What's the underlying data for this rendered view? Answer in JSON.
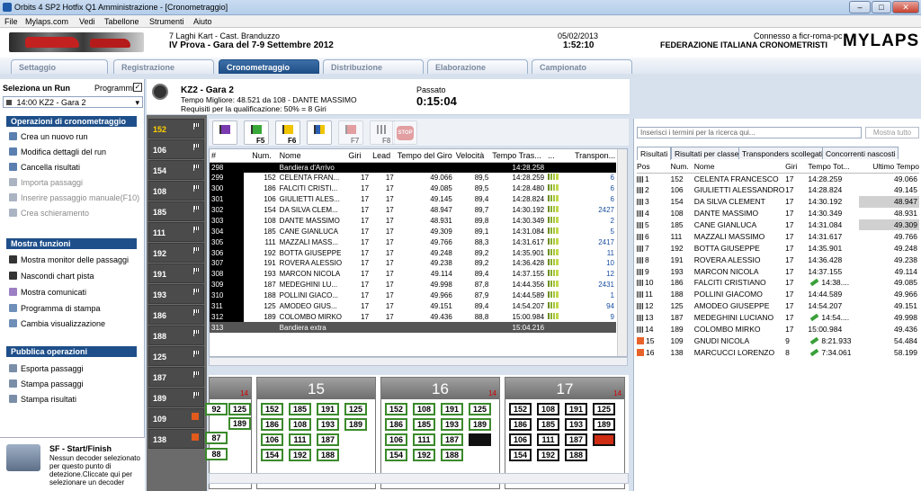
{
  "window": {
    "title": "Orbits 4 SP2 Hotfix Q1 Amministrazione - [Cronometraggio]",
    "buttons": [
      "–",
      "□",
      "✕"
    ]
  },
  "menu": [
    "File",
    "Mylaps.com",
    "Vedi",
    "Tabellone",
    "Strumenti",
    "Aiuto"
  ],
  "header": {
    "event_line1": "7 Laghi Kart - Cast. Branduzzo",
    "event_line2": "IV Prova - Gara del 7-9 Settembre 2012",
    "date": "05/02/2013",
    "time": "1:52:10",
    "connection": "Connesso a ficr-roma-pc",
    "federation": "FEDERAZIONE ITALIANA CRONOMETRISTI",
    "brand": "MYLAPS"
  },
  "tabs": [
    "Settaggio",
    "Registrazione",
    "Cronometraggio",
    "Distribuzione",
    "Elaborazione",
    "Campionato"
  ],
  "left": {
    "select_run_label": "Seleziona un Run",
    "programmi_label": "Programmi",
    "programmi_checked": "✓",
    "run_value": "14:00   KZ2 - Gara 2",
    "sec1_title": "Operazioni di cronometraggio",
    "sec1_items": [
      "Crea un nuovo run",
      "Modifica dettagli del run",
      "Cancella risultati",
      "Importa passaggi",
      "Inserire passaggio manuale(F10)",
      "Crea schieramento"
    ],
    "sec2_title": "Mostra funzioni",
    "sec2_items": [
      "Mostra monitor delle passaggi",
      "Nascondi chart pista",
      "Mostra comunicati",
      "Programma di stampa",
      "Cambia visualizzazione"
    ],
    "sec3_title": "Pubblica operazioni",
    "sec3_items": [
      "Esporta passaggi",
      "Stampa passaggi",
      "Stampa risultati"
    ],
    "sf_title": "SF - Start/Finish",
    "sf_text": "Nessun decoder selezionato per questo punto di detezione.Cliccate qui per selezionare un decoder"
  },
  "race": {
    "name": "KZ2 - Gara 2",
    "best": "Tempo Migliore: 48.521 da 108 - DANTE MASSIMO",
    "req": "Requisiti per la qualificazione: 50% = 8 Giri",
    "elapsed_label": "Passato",
    "elapsed": "0:15:04"
  },
  "numbers_col": [
    "152",
    "106",
    "154",
    "108",
    "185",
    "111",
    "192",
    "191",
    "193",
    "186",
    "188",
    "125",
    "187",
    "189",
    "109",
    "138"
  ],
  "flags": [
    "",
    "F5",
    "F6",
    "",
    "F7",
    "F8",
    "STOP"
  ],
  "grid": {
    "headers": [
      "#",
      "Num.",
      "Nome",
      "Giri",
      "Lead",
      "Tempo del Giro",
      "Velocità",
      "Tempo Tras...",
      "...",
      "Transpon..."
    ],
    "rows": [
      {
        "id": "298",
        "num": "",
        "name": "Bandiera d'Arrivo",
        "giri": "",
        "lead": "",
        "lap": "",
        "vel": "",
        "tt": "14:28.258",
        "tr": "",
        "type": "blk"
      },
      {
        "id": "299",
        "num": "152",
        "name": "CELENTA FRAN...",
        "giri": "17",
        "lead": "17",
        "lap": "49.066",
        "vel": "89,5",
        "tt": "14:28.259",
        "tr": "6"
      },
      {
        "id": "300",
        "num": "186",
        "name": "FALCITI CRISTI...",
        "giri": "17",
        "lead": "17",
        "lap": "49.085",
        "vel": "89,5",
        "tt": "14:28.480",
        "tr": "6"
      },
      {
        "id": "301",
        "num": "106",
        "name": "GIULIETTI ALES...",
        "giri": "17",
        "lead": "17",
        "lap": "49.145",
        "vel": "89,4",
        "tt": "14:28.824",
        "tr": "6"
      },
      {
        "id": "302",
        "num": "154",
        "name": "DA SILVA CLEM...",
        "giri": "17",
        "lead": "17",
        "lap": "48.947",
        "vel": "89,7",
        "tt": "14:30.192",
        "tr": "2427"
      },
      {
        "id": "303",
        "num": "108",
        "name": "DANTE MASSIMO",
        "giri": "17",
        "lead": "17",
        "lap": "48.931",
        "vel": "89,8",
        "tt": "14:30.349",
        "tr": "2"
      },
      {
        "id": "304",
        "num": "185",
        "name": "CANE GIANLUCA",
        "giri": "17",
        "lead": "17",
        "lap": "49.309",
        "vel": "89,1",
        "tt": "14:31.084",
        "tr": "5"
      },
      {
        "id": "305",
        "num": "111",
        "name": "MAZZALI MASS...",
        "giri": "17",
        "lead": "17",
        "lap": "49.766",
        "vel": "88,3",
        "tt": "14:31.617",
        "tr": "2417"
      },
      {
        "id": "306",
        "num": "192",
        "name": "BOTTA GIUSEPPE",
        "giri": "17",
        "lead": "17",
        "lap": "49.248",
        "vel": "89,2",
        "tt": "14:35.901",
        "tr": "11"
      },
      {
        "id": "307",
        "num": "191",
        "name": "ROVERA ALESSIO",
        "giri": "17",
        "lead": "17",
        "lap": "49.238",
        "vel": "89,2",
        "tt": "14:36.428",
        "tr": "10"
      },
      {
        "id": "308",
        "num": "193",
        "name": "MARCON NICOLA",
        "giri": "17",
        "lead": "17",
        "lap": "49.114",
        "vel": "89,4",
        "tt": "14:37.155",
        "tr": "12"
      },
      {
        "id": "309",
        "num": "187",
        "name": "MEDEGHINI LU...",
        "giri": "17",
        "lead": "17",
        "lap": "49.998",
        "vel": "87,8",
        "tt": "14:44.356",
        "tr": "2431"
      },
      {
        "id": "310",
        "num": "188",
        "name": "POLLINI GIACO...",
        "giri": "17",
        "lead": "17",
        "lap": "49.966",
        "vel": "87,9",
        "tt": "14:44.589",
        "tr": "1"
      },
      {
        "id": "311",
        "num": "125",
        "name": "AMODEO GIUS...",
        "giri": "17",
        "lead": "17",
        "lap": "49.151",
        "vel": "89,4",
        "tt": "14:54.207",
        "tr": "94"
      },
      {
        "id": "312",
        "num": "189",
        "name": "COLOMBO MIRKO",
        "giri": "17",
        "lead": "17",
        "lap": "49.436",
        "vel": "88,8",
        "tt": "15:00.984",
        "tr": "9"
      },
      {
        "id": "313",
        "num": "",
        "name": "Bandiera extra",
        "giri": "",
        "lead": "",
        "lap": "",
        "vel": "",
        "tt": "15:04.216",
        "tr": "",
        "type": "gray"
      }
    ]
  },
  "laps": [
    {
      "lap": "",
      "sub": "14",
      "cells": [
        "92",
        "125",
        "189",
        "",
        "",
        "",
        "87",
        "",
        "",
        "88",
        "",
        ""
      ]
    },
    {
      "lap": "15",
      "sub": "",
      "cells": [
        "152",
        "185",
        "191",
        "125",
        "186",
        "108",
        "193",
        "189",
        "106",
        "111",
        "187",
        "",
        "154",
        "192",
        "188",
        ""
      ]
    },
    {
      "lap": "16",
      "sub": "14",
      "cells": [
        "152",
        "108",
        "191",
        "125",
        "186",
        "185",
        "193",
        "189",
        "106",
        "111",
        "187",
        "",
        "154",
        "192",
        "188",
        ""
      ]
    },
    {
      "lap": "17",
      "sub": "14",
      "cells": [
        "152",
        "108",
        "191",
        "125",
        "186",
        "185",
        "193",
        "189",
        "106",
        "111",
        "187",
        "",
        "154",
        "192",
        "188",
        ""
      ]
    }
  ],
  "right": {
    "search_placeholder": "Inserisci i termini per la ricerca qui...",
    "search_button": "Mostra tutto",
    "tabs": [
      "Risultati",
      "Risultati per classe",
      "Transponders scollegati",
      "Concorrenti nascosti"
    ],
    "headers": [
      "Pos",
      "Num.",
      "Nome",
      "Giri",
      "Tempo Tot...",
      "Ultimo Tempo"
    ],
    "rows": [
      {
        "pos": "1",
        "num": "152",
        "name": "CELENTA FRANCESCO",
        "giri": "17",
        "tt": "14:28.259",
        "last": "49.066"
      },
      {
        "pos": "2",
        "num": "106",
        "name": "GIULIETTI ALESSANDRO",
        "giri": "17",
        "tt": "14:28.824",
        "last": "49.145"
      },
      {
        "pos": "3",
        "num": "154",
        "name": "DA SILVA CLEMENT",
        "giri": "17",
        "tt": "14:30.192",
        "last": "48.947"
      },
      {
        "pos": "4",
        "num": "108",
        "name": "DANTE MASSIMO",
        "giri": "17",
        "tt": "14:30.349",
        "last": "48.931"
      },
      {
        "pos": "5",
        "num": "185",
        "name": "CANE GIANLUCA",
        "giri": "17",
        "tt": "14:31.084",
        "last": "49.309"
      },
      {
        "pos": "6",
        "num": "111",
        "name": "MAZZALI MASSIMO",
        "giri": "17",
        "tt": "14:31.617",
        "last": "49.766"
      },
      {
        "pos": "7",
        "num": "192",
        "name": "BOTTA GIUSEPPE",
        "giri": "17",
        "tt": "14:35.901",
        "last": "49.248"
      },
      {
        "pos": "8",
        "num": "191",
        "name": "ROVERA ALESSIO",
        "giri": "17",
        "tt": "14:36.428",
        "last": "49.238"
      },
      {
        "pos": "9",
        "num": "193",
        "name": "MARCON NICOLA",
        "giri": "17",
        "tt": "14:37.155",
        "last": "49.114"
      },
      {
        "pos": "10",
        "num": "186",
        "name": "FALCITI CRISTIANO",
        "giri": "17",
        "tt": "14:38....",
        "last": "49.085"
      },
      {
        "pos": "11",
        "num": "188",
        "name": "POLLINI GIACOMO",
        "giri": "17",
        "tt": "14:44.589",
        "last": "49.966"
      },
      {
        "pos": "12",
        "num": "125",
        "name": "AMODEO GIUSEPPE",
        "giri": "17",
        "tt": "14:54.207",
        "last": "49.151"
      },
      {
        "pos": "13",
        "num": "187",
        "name": "MEDEGHINI LUCIANO",
        "giri": "17",
        "tt": "14:54....",
        "last": "49.998"
      },
      {
        "pos": "14",
        "num": "189",
        "name": "COLOMBO MIRKO",
        "giri": "17",
        "tt": "15:00.984",
        "last": "49.436"
      },
      {
        "pos": "15",
        "num": "109",
        "name": "GNUDI NICOLA",
        "giri": "9",
        "tt": "8:21.933",
        "last": "54.484"
      },
      {
        "pos": "16",
        "num": "138",
        "name": "MARCUCCI LORENZO",
        "giri": "8",
        "tt": "7:34.061",
        "last": "58.199"
      }
    ]
  },
  "colors": {
    "accent": "#1e4f8a",
    "active_tab": "#2a5d96",
    "flag_orange": "#e25a1c"
  }
}
